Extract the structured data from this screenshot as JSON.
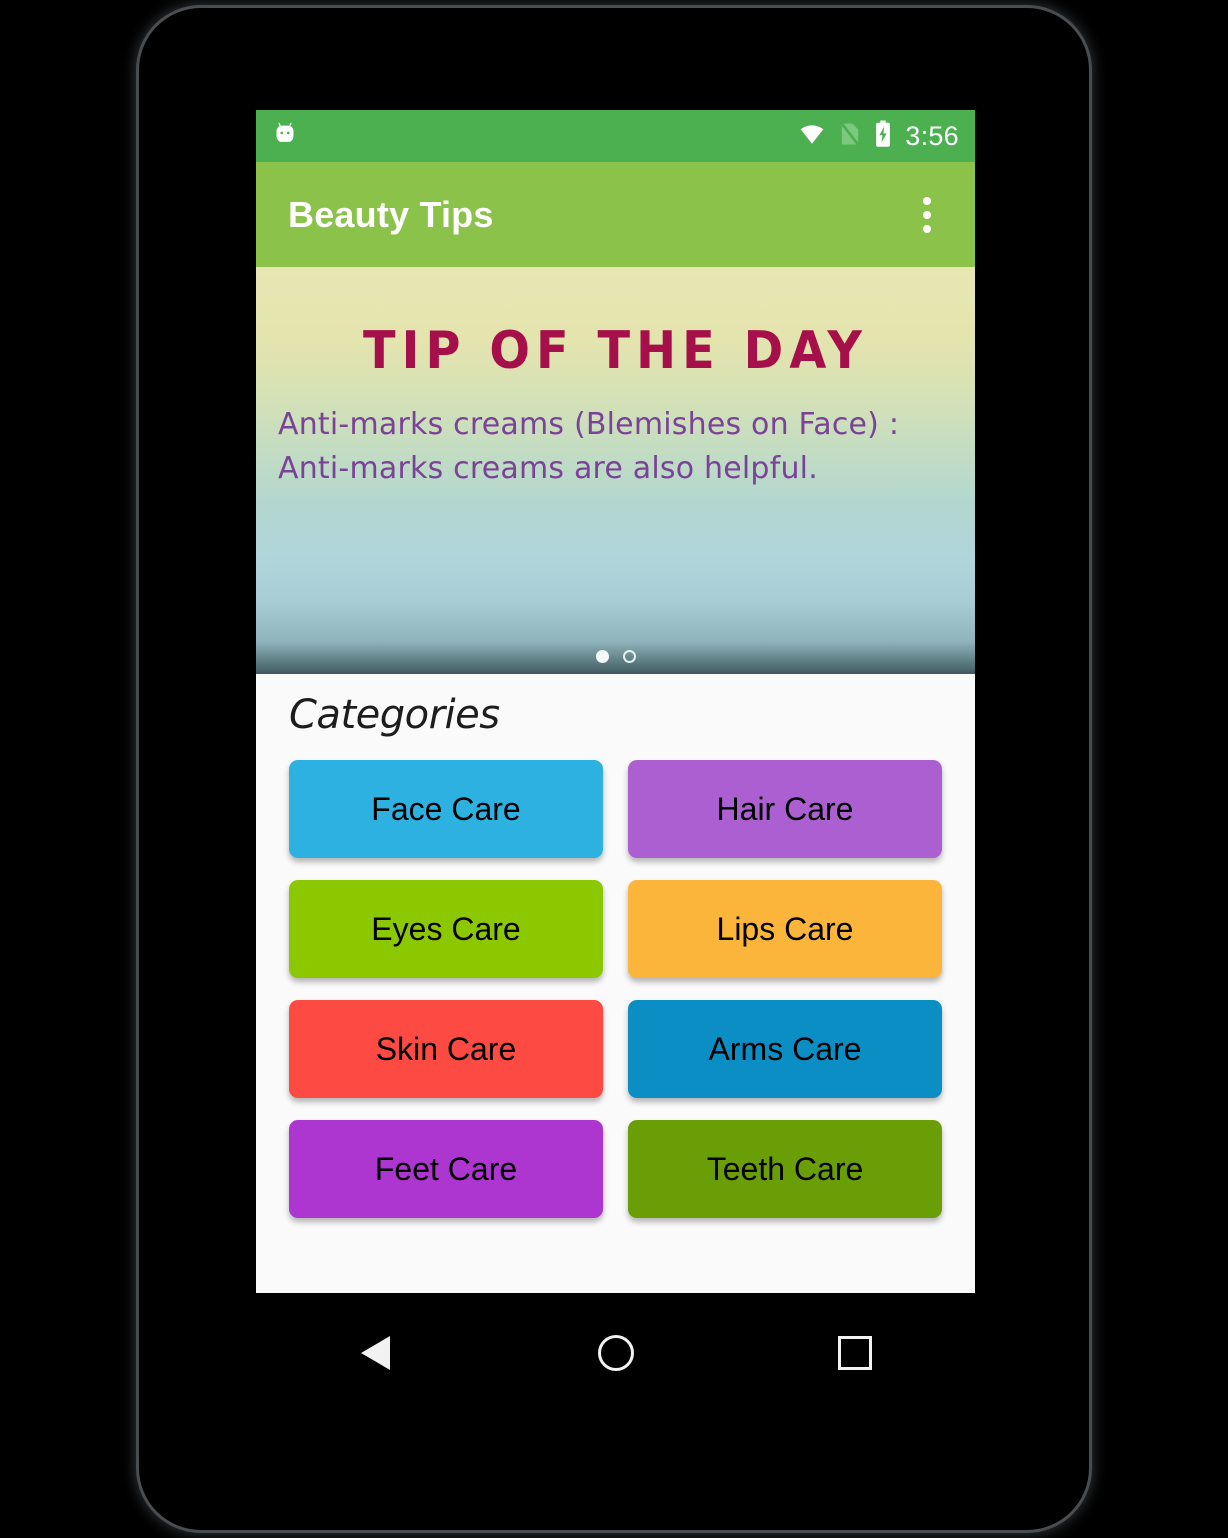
{
  "status_bar": {
    "notification_icon": "android-robot-icon",
    "wifi_icon": "wifi-icon",
    "sim_icon": "no-sim-icon",
    "battery_icon": "battery-charging-icon",
    "clock": "3:56",
    "background_color": "#4caf50"
  },
  "app_bar": {
    "title": "Beauty Tips",
    "overflow_icon": "overflow-menu-icon",
    "background_color": "#8bc34a",
    "title_color": "#ffffff"
  },
  "tip_card": {
    "title": "TIP OF THE DAY",
    "title_color": "#a50f4a",
    "body": "Anti-marks creams (Blemishes on Face) : Anti-marks creams are also helpful.",
    "body_color": "#7b4397",
    "gradient_top": "#e8e7b4",
    "gradient_bottom": "#3b585e",
    "page_dots": [
      {
        "label": "page-1",
        "active": true
      },
      {
        "label": "page-2",
        "active": false
      }
    ]
  },
  "categories": {
    "heading": "Categories",
    "items": [
      {
        "label": "Face Care",
        "color": "#2cb1e0"
      },
      {
        "label": "Hair Care",
        "color": "#ac5fd1"
      },
      {
        "label": "Eyes Care",
        "color": "#8cc800"
      },
      {
        "label": "Lips Care",
        "color": "#fcb53b"
      },
      {
        "label": "Skin Care",
        "color": "#fd4a43"
      },
      {
        "label": "Arms Care",
        "color": "#0b8ec4"
      },
      {
        "label": "Feet Care",
        "color": "#ad36d1"
      },
      {
        "label": "Teeth Care",
        "color": "#6a9e07"
      }
    ]
  },
  "nav_bar": {
    "back_icon": "back-triangle-icon",
    "home_icon": "home-circle-icon",
    "recents_icon": "recents-square-icon",
    "background_color": "#000000"
  }
}
